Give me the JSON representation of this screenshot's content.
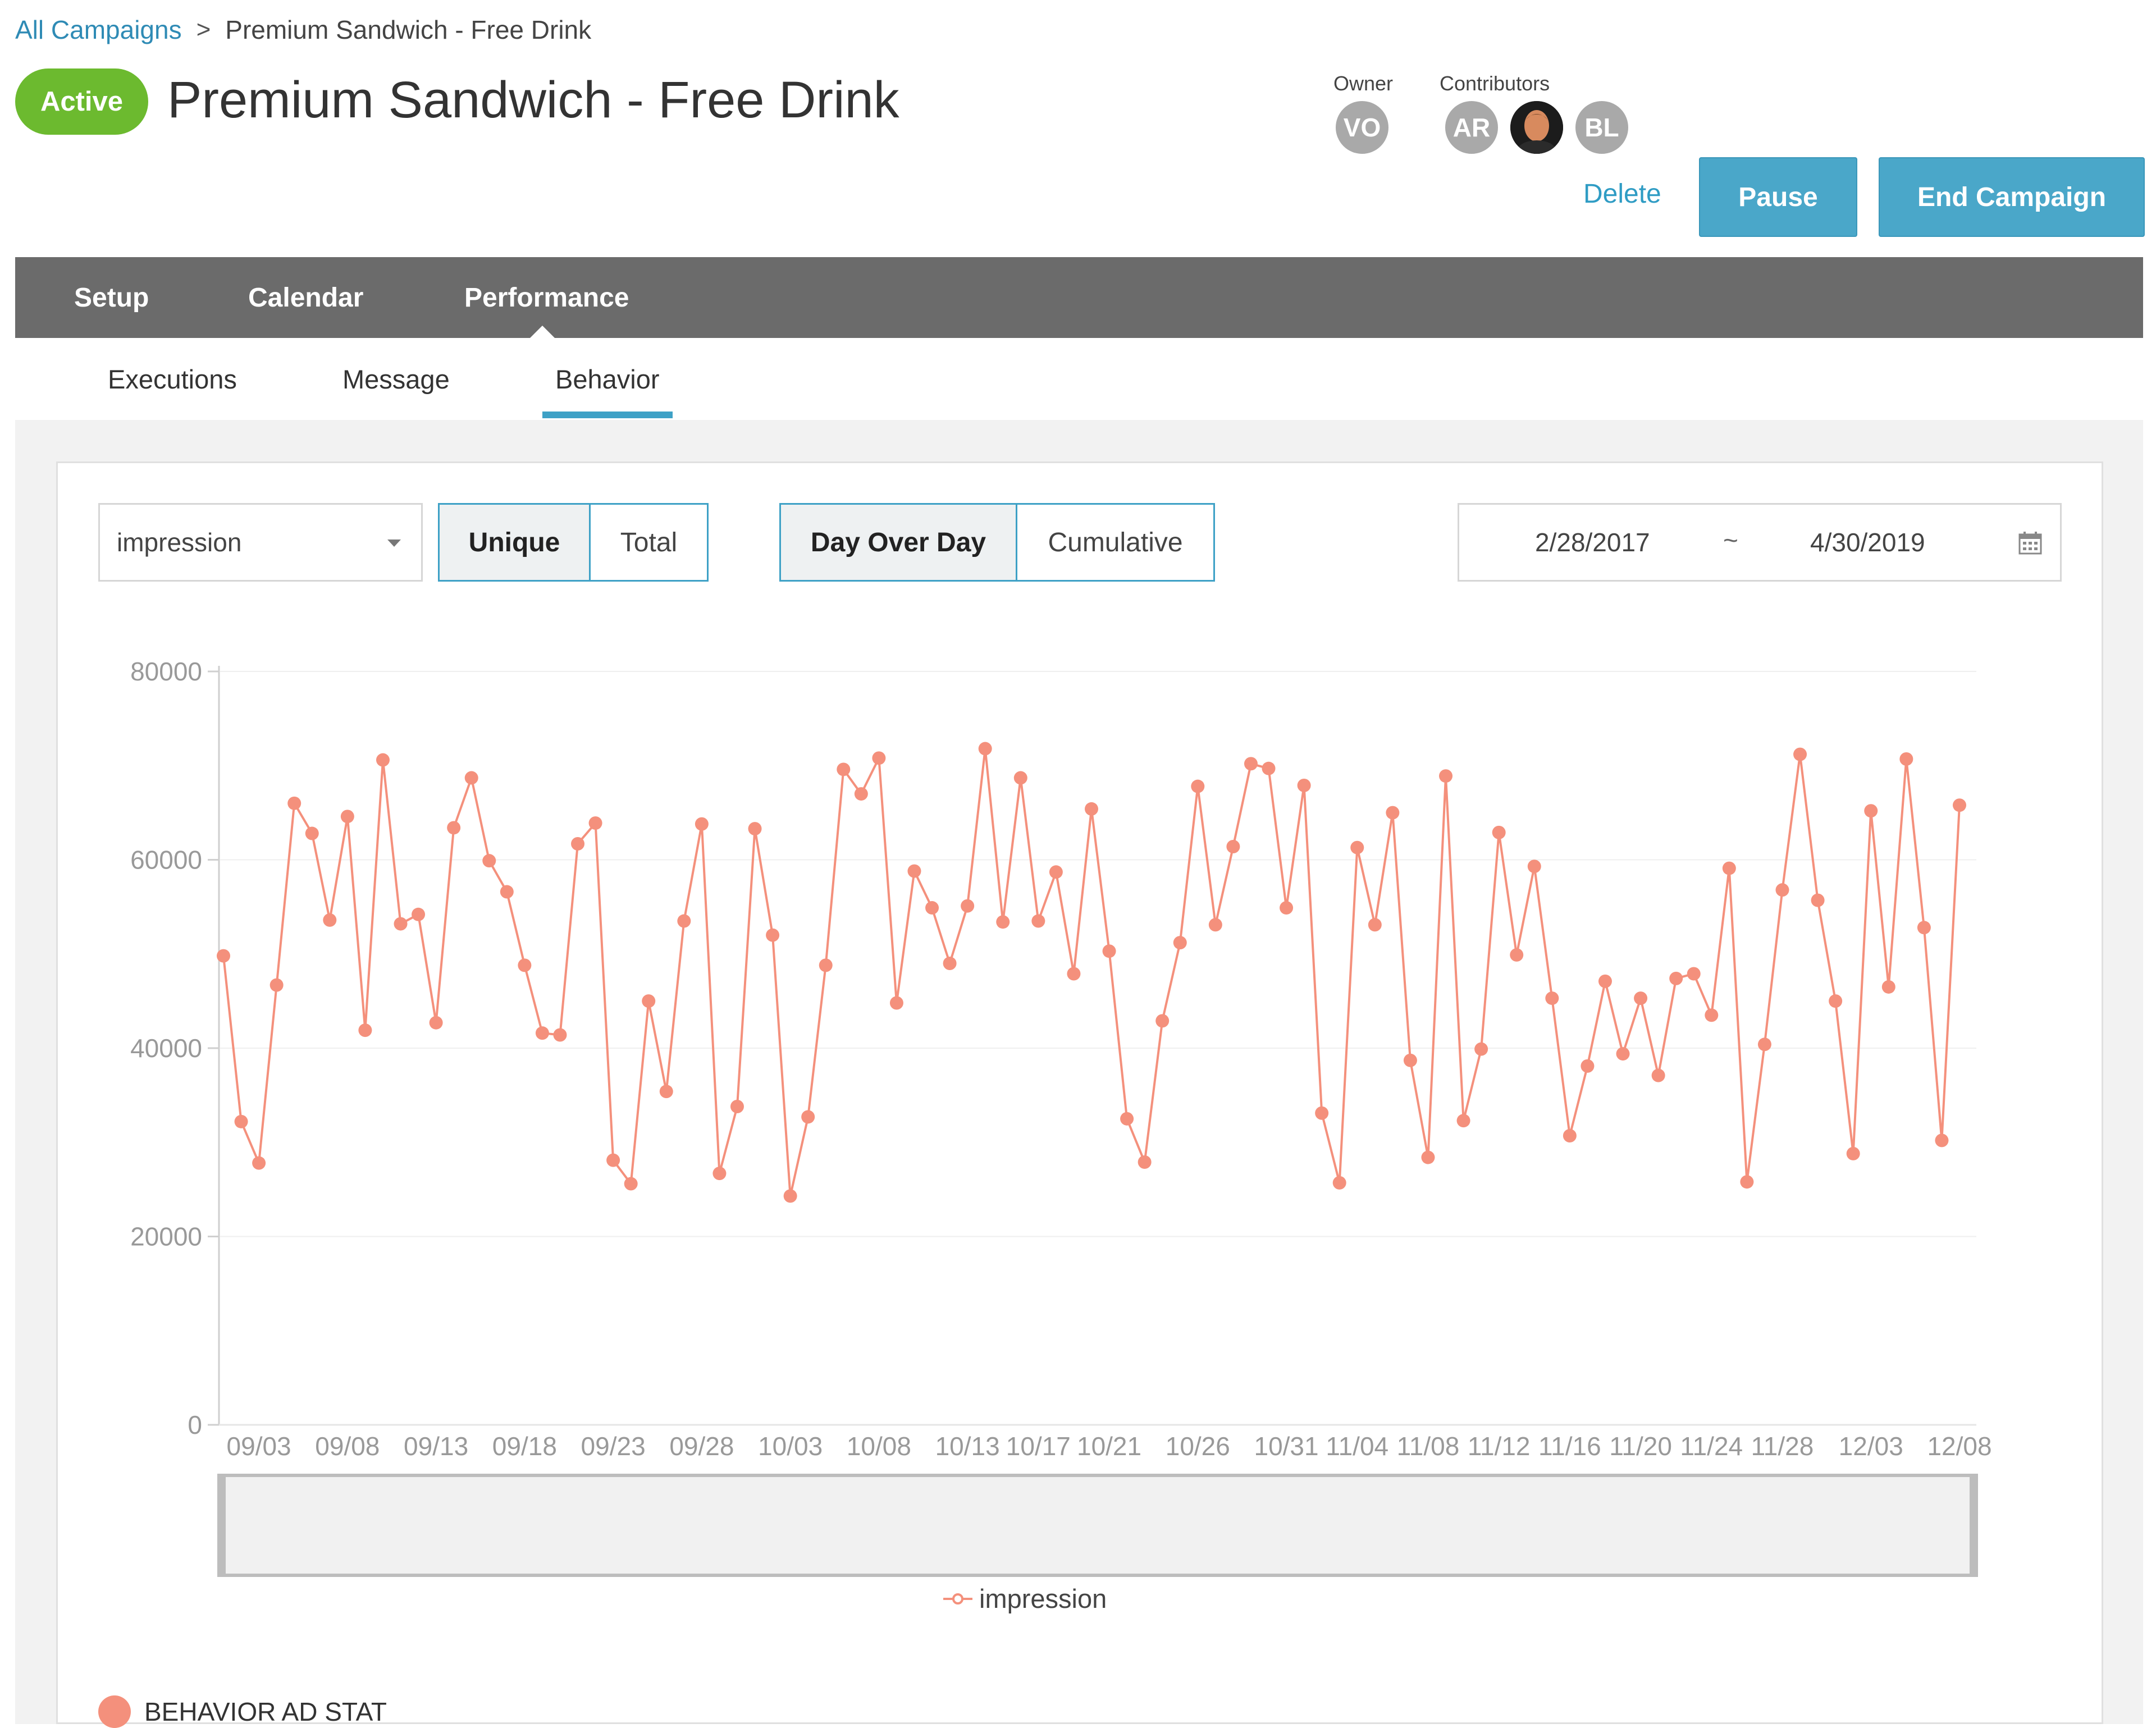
{
  "breadcrumb": {
    "root": "All Campaigns",
    "separator": ">",
    "current": "Premium Sandwich - Free Drink"
  },
  "campaign": {
    "status": "Active",
    "title": "Premium Sandwich - Free Drink"
  },
  "people": {
    "owner_label": "Owner",
    "owner": [
      "VO"
    ],
    "contributors_label": "Contributors",
    "contributors": [
      "AR",
      "",
      "BL"
    ]
  },
  "actions": {
    "delete": "Delete",
    "pause": "Pause",
    "end": "End Campaign"
  },
  "tabs": {
    "main": [
      "Setup",
      "Calendar",
      "Performance"
    ],
    "active_main": "Performance",
    "sub": [
      "Executions",
      "Message",
      "Behavior"
    ],
    "active_sub": "Behavior"
  },
  "controls": {
    "metric": "impression",
    "count_mode": [
      "Unique",
      "Total"
    ],
    "count_mode_selected": "Unique",
    "view_mode": [
      "Day Over Day",
      "Cumulative"
    ],
    "view_mode_selected": "Day Over Day",
    "date_start": "2/28/2017",
    "date_separator": "~",
    "date_end": "4/30/2019"
  },
  "section_label": "BEHAVIOR AD STAT",
  "colors": {
    "accent": "#3ea1c6",
    "active": "#6cba2f",
    "series": "#f4907c",
    "tabbar": "#6b6b6b"
  },
  "chart_data": {
    "type": "line",
    "ylim": [
      0,
      80000
    ],
    "y_ticks": [
      0,
      20000,
      40000,
      60000,
      80000
    ],
    "x_tick_labels": [
      "09/03",
      "09/08",
      "09/13",
      "09/18",
      "09/23",
      "09/28",
      "10/03",
      "10/08",
      "10/13",
      "10/17",
      "10/21",
      "10/26",
      "10/31",
      "11/04",
      "11/08",
      "11/12",
      "11/16",
      "11/20",
      "11/24",
      "11/28",
      "12/03",
      "12/08"
    ],
    "x_tick_positions": [
      2,
      7,
      12,
      17,
      22,
      27,
      32,
      37,
      42,
      46,
      50,
      55,
      60,
      64,
      68,
      72,
      76,
      80,
      84,
      88,
      93,
      98
    ],
    "legend": "top-none / bottom-center",
    "series": [
      {
        "name": "impression",
        "values": [
          49800,
          32200,
          27800,
          46700,
          66000,
          62800,
          53600,
          64600,
          41900,
          70600,
          53200,
          54200,
          42700,
          63400,
          68700,
          59900,
          56600,
          48800,
          41600,
          41400,
          61700,
          63900,
          28100,
          25600,
          45000,
          35400,
          53500,
          63800,
          26700,
          33800,
          63300,
          52000,
          24300,
          32700,
          48800,
          69600,
          67000,
          70800,
          44800,
          58800,
          54900,
          49000,
          55100,
          71800,
          53400,
          68700,
          53500,
          58700,
          47900,
          65400,
          50300,
          32500,
          27900,
          42900,
          51200,
          67800,
          53100,
          61400,
          70200,
          69700,
          54900,
          67900,
          33100,
          25700,
          61300,
          53100,
          65000,
          38700,
          28400,
          68900,
          32300,
          39900,
          62900,
          49900,
          59300,
          45300,
          30700,
          38100,
          47100,
          39400,
          45300,
          37100,
          47400,
          47900,
          43500,
          59100,
          25800,
          40400,
          56800,
          71200,
          55700,
          45000,
          28800,
          65200,
          46500,
          70700,
          52800,
          30200,
          65800
        ]
      }
    ]
  }
}
